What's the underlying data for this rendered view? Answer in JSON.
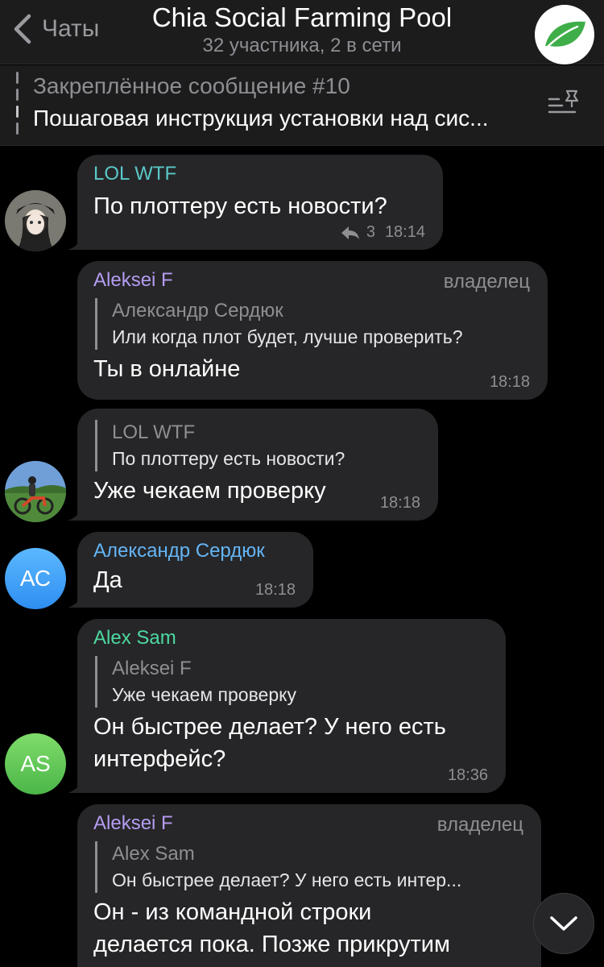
{
  "header": {
    "back_label": "Чаты",
    "title": "Chia Social Farming Pool",
    "subtitle": "32 участника, 2 в сети"
  },
  "pinned": {
    "title": "Закреплённое сообщение #10",
    "text": "Пошаговая инструкция установки над сис..."
  },
  "colors": {
    "lol_wtf": "#5ac8c8",
    "aleksei_f": "#b49cf0",
    "alexandr": "#64b5f6",
    "alex_sam": "#4cd9a0"
  },
  "messages": [
    {
      "sender": "LOL WTF",
      "text": "По плоттеру есть новости?",
      "replies_count": "3",
      "time": "18:14"
    },
    {
      "sender": "Aleksei F",
      "role": "владелец",
      "reply_name": "Александр Сердюк",
      "reply_text": "Или когда плот будет, лучше проверить?",
      "text": "Ты в онлайне",
      "time": "18:18"
    },
    {
      "reply_name": "LOL WTF",
      "reply_text": "По плоттеру есть новости?",
      "text": "Уже чекаем проверку",
      "time": "18:18"
    },
    {
      "sender": "Александр Сердюк",
      "avatar_initials": "АС",
      "text": "Да",
      "time": "18:18"
    },
    {
      "sender": "Alex Sam",
      "avatar_initials": "AS",
      "reply_name": "Aleksei F",
      "reply_text": "Уже чекаем проверку",
      "text_line1": "Он быстрее делает? У него есть",
      "text_line2": "интерфейс?",
      "time": "18:36"
    },
    {
      "sender": "Aleksei F",
      "role": "владелец",
      "reply_name": "Alex Sam",
      "reply_text": "Он быстрее делает? У него есть интер...",
      "text_line1": "Он - из командной строки",
      "text_line2": "делается пока. Позже прикрутим"
    }
  ]
}
